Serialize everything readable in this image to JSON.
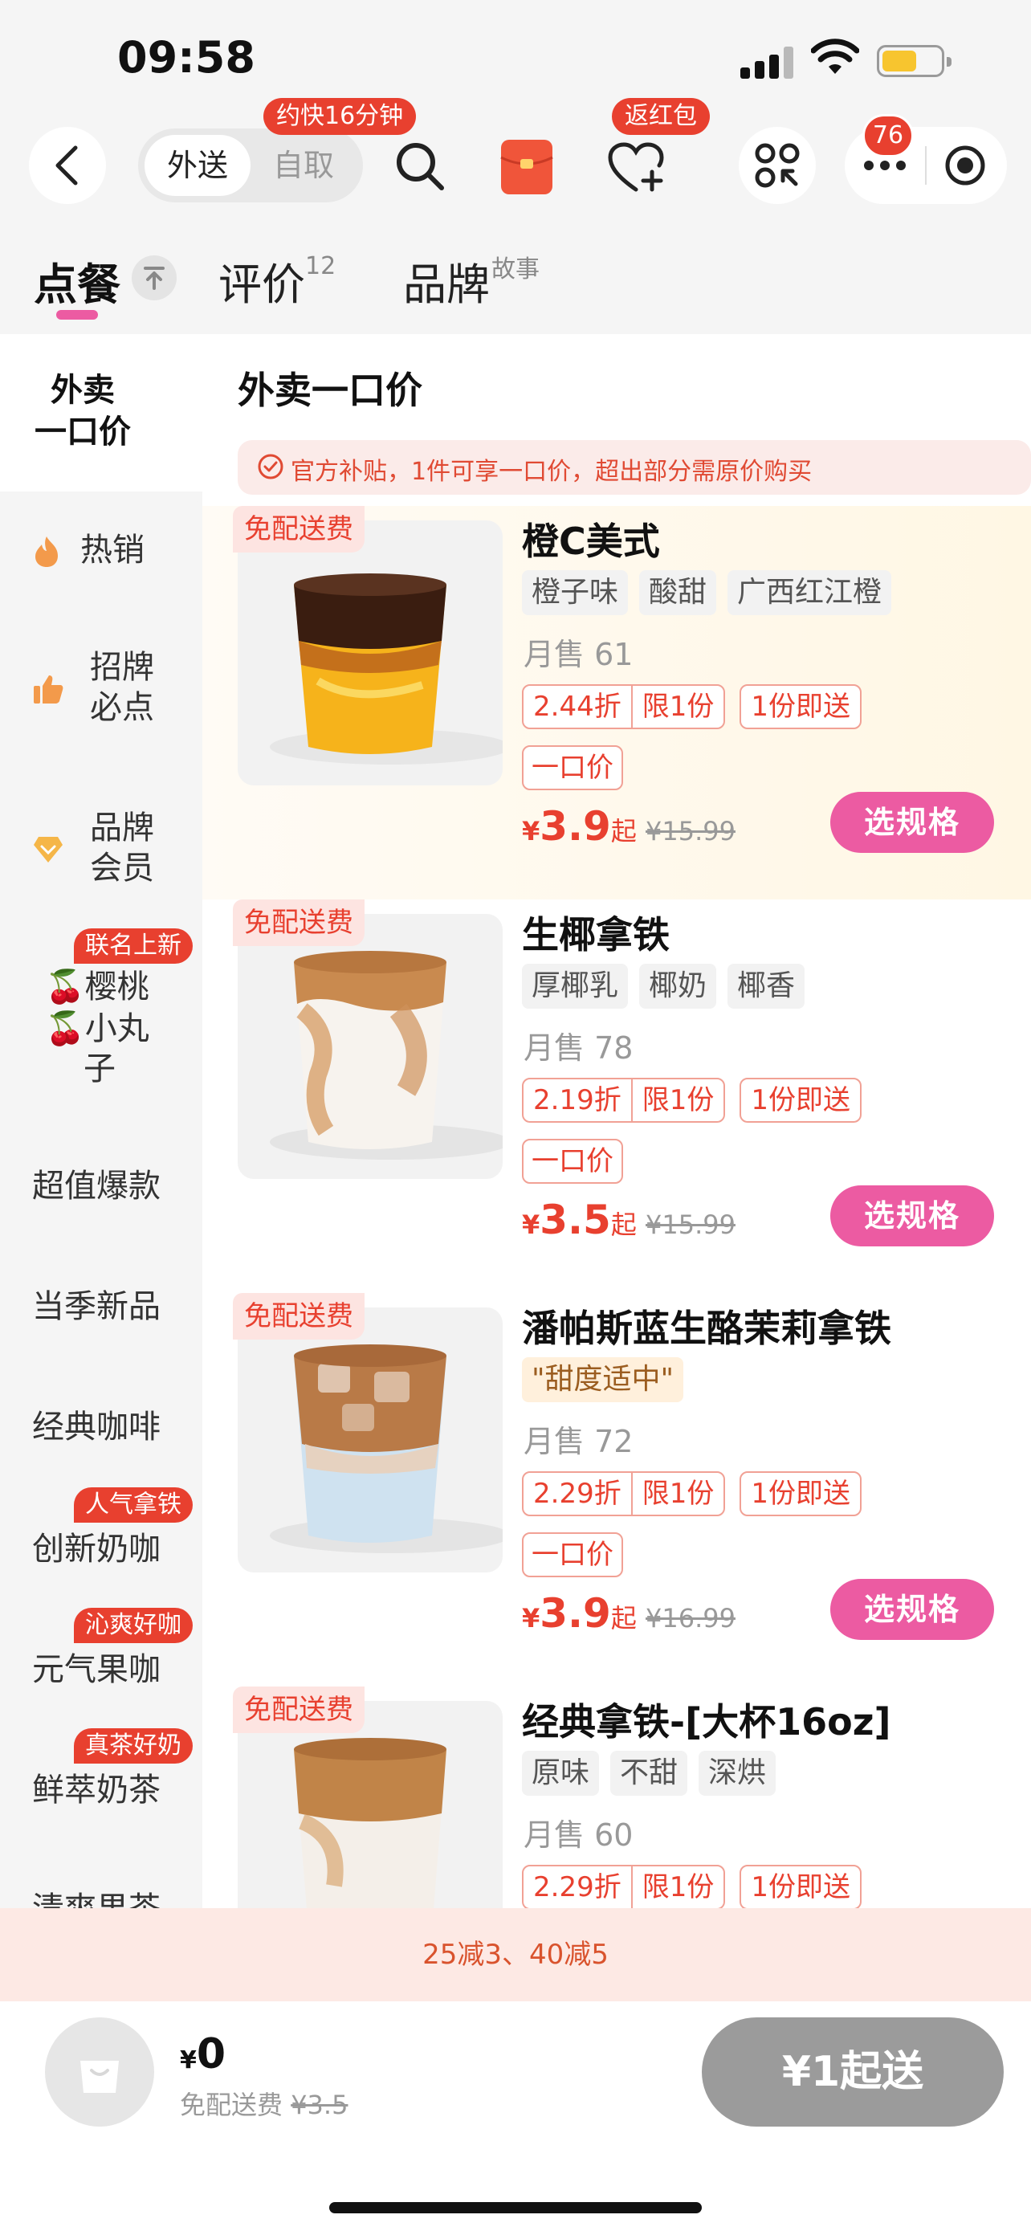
{
  "status_bar": {
    "time": "09:58"
  },
  "header": {
    "mode_tabs": [
      "外送",
      "自取"
    ],
    "eta_bubble": "约快16分钟",
    "hongbao_bubble": "返红包",
    "more_badge": "76"
  },
  "tabs": {
    "order": "点餐",
    "review": "评价",
    "review_count": "12",
    "brand": "品牌",
    "brand_sup": "故事"
  },
  "sidebar": {
    "active": [
      "外卖",
      "一口价"
    ],
    "items": [
      {
        "lines": [
          "热销"
        ],
        "icon": "fire-icon"
      },
      {
        "lines": [
          "招牌",
          "必点"
        ],
        "icon": "thumb-up-icon"
      },
      {
        "lines": [
          "品牌",
          "会员"
        ],
        "icon": "member-diamond-icon"
      },
      {
        "lines": [
          "🍒樱桃",
          "🍒小丸",
          "子"
        ],
        "tag": "联名上新"
      },
      {
        "lines": [
          "超值爆款"
        ]
      },
      {
        "lines": [
          "当季新品"
        ]
      },
      {
        "lines": [
          "经典咖啡"
        ]
      },
      {
        "lines": [
          "创新奶咖"
        ],
        "tag": "人气拿铁"
      },
      {
        "lines": [
          "元气果咖"
        ],
        "tag": "沁爽好咖"
      },
      {
        "lines": [
          "鲜萃奶茶"
        ],
        "tag": "真茶好奶"
      },
      {
        "lines": [
          "清爽果茶"
        ]
      }
    ]
  },
  "section": {
    "title": "外卖一口价",
    "notice": "官方补贴，1件可享一口价，超出部分需原价购买"
  },
  "products": [
    {
      "free_tag": "免配送费",
      "name": "橙C美式",
      "tags": [
        "橙子味",
        "酸甜",
        "广西红江橙"
      ],
      "tag_style": "gray",
      "sales": "月售 61",
      "discount": "2.44折",
      "limit": "限1份",
      "deliver": "1份即送",
      "flat": "一口价",
      "currency": "¥",
      "price": "3.9",
      "price_suffix": "起",
      "original": "¥15.99",
      "button": "选规格"
    },
    {
      "free_tag": "免配送费",
      "name": "生椰拿铁",
      "tags": [
        "厚椰乳",
        "椰奶",
        "椰香"
      ],
      "tag_style": "gray",
      "sales": "月售 78",
      "discount": "2.19折",
      "limit": "限1份",
      "deliver": "1份即送",
      "flat": "一口价",
      "currency": "¥",
      "price": "3.5",
      "price_suffix": "起",
      "original": "¥15.99",
      "button": "选规格"
    },
    {
      "free_tag": "免配送费",
      "name": "潘帕斯蓝生酪茉莉拿铁",
      "tags": [
        "\"甜度适中\""
      ],
      "tag_style": "warm",
      "sales": "月售 72",
      "discount": "2.29折",
      "limit": "限1份",
      "deliver": "1份即送",
      "flat": "一口价",
      "currency": "¥",
      "price": "3.9",
      "price_suffix": "起",
      "original": "¥16.99",
      "button": "选规格"
    },
    {
      "free_tag": "免配送费",
      "name": "经典拿铁-[大杯16oz]",
      "tags": [
        "原味",
        "不甜",
        "深烘"
      ],
      "tag_style": "gray",
      "sales": "月售 60",
      "discount": "2.29折",
      "limit": "限1份",
      "deliver": "1份即送"
    }
  ],
  "promo": "25减3、40减5",
  "cart": {
    "currency": "¥",
    "total": "0",
    "fee_label": "免配送费",
    "fee_original": "¥3.5",
    "checkout": "¥1起送"
  },
  "colors": {
    "accent_pink": "#ec5ba2",
    "price_red": "#e8402f",
    "checkout_gray": "#9b9b9b"
  }
}
